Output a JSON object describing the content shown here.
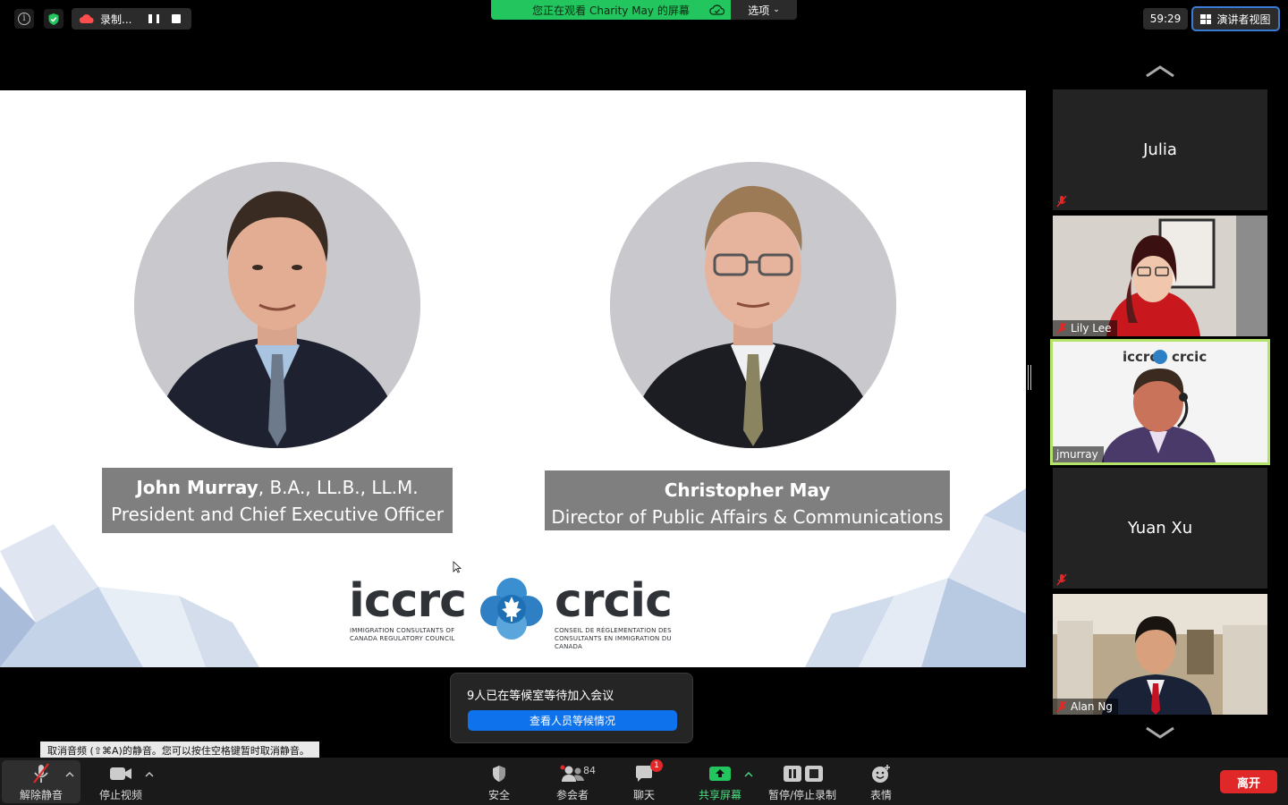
{
  "top_bar": {
    "recording_label": "录制...",
    "share_banner": "您正在观看 Charity May 的屏幕",
    "options_label": "选项",
    "timer": "59:29",
    "speaker_view_label": "演讲者视图"
  },
  "slide": {
    "person1": {
      "name": "John Murray",
      "credentials": ", B.A., LL.B., LL.M.",
      "title": "President and Chief Executive Officer"
    },
    "person2": {
      "name": "Christopher May",
      "title": "Director of Public Affairs & Communications"
    },
    "logo": {
      "left_word": "iccrc",
      "right_word": "crcic",
      "left_sub_1": "IMMIGRATION CONSULTANTS OF",
      "left_sub_2": "CANADA REGULATORY COUNCIL",
      "right_sub_1": "CONSEIL DE RÉGLEMENTATION DES",
      "right_sub_2": "CONSULTANTS EN IMMIGRATION DU CANADA"
    }
  },
  "participants": [
    {
      "name": "Julia",
      "video": false,
      "muted": true
    },
    {
      "name": "Lily Lee",
      "video": true,
      "muted": true
    },
    {
      "name": "jmurray",
      "video": true,
      "muted": false,
      "active_speaker": true
    },
    {
      "name": "Yuan Xu",
      "video": false,
      "muted": true
    },
    {
      "name": "Alan Ng",
      "video": true,
      "muted": true
    }
  ],
  "active_tile_logo": {
    "left": "iccrc",
    "right": "crcic"
  },
  "waiting_room": {
    "message": "9人已在等候室等待加入会议",
    "button_label": "查看人员等候情况"
  },
  "tooltip": "取消音频 (⇧⌘A)的静音。您可以按住空格键暂时取消静音。",
  "toolbar": {
    "unmute": "解除静音",
    "stop_video": "停止视频",
    "security": "安全",
    "participants": "参会者",
    "participants_count": "84",
    "chat": "聊天",
    "chat_badge": "1",
    "share_screen": "共享屏幕",
    "pause_stop_recording": "暂停/停止录制",
    "reactions": "表情",
    "leave": "离开"
  },
  "colors": {
    "share_green": "#22c55e",
    "active_border": "#b4e36a",
    "leave_red": "#e02828",
    "primary_blue": "#0e72ed",
    "caption_gray": "#7f7f7f"
  }
}
